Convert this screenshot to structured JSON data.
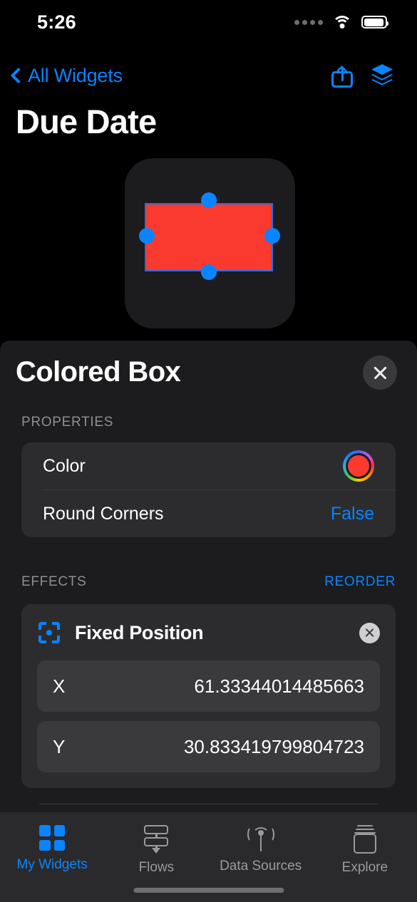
{
  "status_bar": {
    "time": "5:26",
    "signal_icon": "cellular-dots-icon",
    "wifi_icon": "wifi-icon",
    "battery_icon": "battery-icon"
  },
  "nav_bar": {
    "back_label": "All Widgets",
    "back_icon": "chevron-left-icon",
    "share_icon": "share-icon",
    "layers_icon": "layers-icon"
  },
  "page": {
    "title": "Due Date"
  },
  "preview": {
    "canvas_color": "#1C1C1E",
    "shape_color": "#FA3A2E",
    "selection_color": "#0A84FF",
    "handles": [
      "top",
      "right",
      "bottom",
      "left"
    ]
  },
  "sheet": {
    "title": "Colored Box",
    "close_icon": "close-icon",
    "properties": {
      "section_label": "PROPERTIES",
      "rows": [
        {
          "label": "Color",
          "value": "",
          "control": "color-well",
          "color": "#FA3A2E"
        },
        {
          "label": "Round Corners",
          "value": "False",
          "control": "value-link"
        }
      ]
    },
    "effects": {
      "section_label": "EFFECTS",
      "action_label": "REORDER",
      "items": [
        {
          "icon": "fixed-position-icon",
          "title": "Fixed Position",
          "remove_icon": "remove-icon",
          "fields": [
            {
              "key": "X",
              "value": "61.33344014485663"
            },
            {
              "key": "Y",
              "value": "30.833419799804723"
            }
          ]
        }
      ]
    }
  },
  "tab_bar": {
    "items": [
      {
        "label": "My Widgets",
        "icon": "grid-icon",
        "active": true
      },
      {
        "label": "Flows",
        "icon": "flows-icon",
        "active": false
      },
      {
        "label": "Data Sources",
        "icon": "antenna-icon",
        "active": false
      },
      {
        "label": "Explore",
        "icon": "jar-icon",
        "active": false
      }
    ],
    "active_color": "#0A84FF",
    "inactive_color": "#9A9A9E"
  }
}
